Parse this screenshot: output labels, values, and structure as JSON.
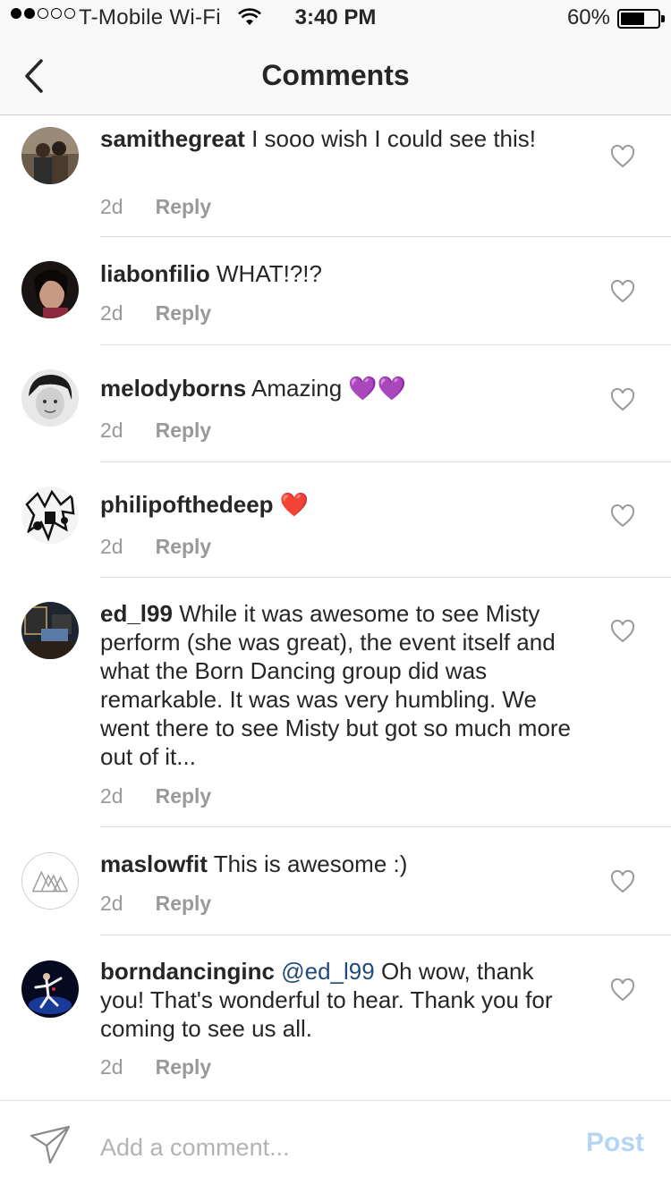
{
  "status_bar": {
    "carrier": "T-Mobile Wi-Fi",
    "time": "3:40 PM",
    "battery": "60%"
  },
  "nav": {
    "title": "Comments"
  },
  "comments": [
    {
      "username": "samithegreat",
      "text": "I sooo wish I could see this!",
      "age": "2d",
      "reply": "Reply"
    },
    {
      "username": "liabonfilio",
      "text": "WHAT!?!?",
      "age": "2d",
      "reply": "Reply"
    },
    {
      "username": "melodyborns",
      "text": "Amazing 💜💜",
      "age": "2d",
      "reply": "Reply"
    },
    {
      "username": "philipofthedeep",
      "text": "❤️",
      "age": "2d",
      "reply": "Reply"
    },
    {
      "username": "ed_l99",
      "text": "While it was awesome to see Misty perform (she was great), the event itself and what the Born Dancing group did was remarkable. It was was very humbling. We went there to see Misty but got so much more out of it...",
      "age": "2d",
      "reply": "Reply"
    },
    {
      "username": "maslowfit",
      "text": "This is awesome :)",
      "age": "2d",
      "reply": "Reply"
    },
    {
      "username": "borndancinginc",
      "mention": "@ed_l99",
      "text": "Oh wow, thank you! That's wonderful to hear. Thank you for coming to see us all.",
      "age": "2d",
      "reply": "Reply"
    }
  ],
  "composer": {
    "placeholder": "Add a comment...",
    "post_label": "Post"
  },
  "colors": {
    "username": "#262626",
    "meta": "#999999",
    "mention": "#1f4a7a",
    "post_disabled": "#b4d5f5",
    "divider": "#dbdbdb"
  },
  "icons": {
    "back": "chevron-left-icon",
    "like": "heart-outline-icon",
    "send": "paper-plane-icon"
  }
}
